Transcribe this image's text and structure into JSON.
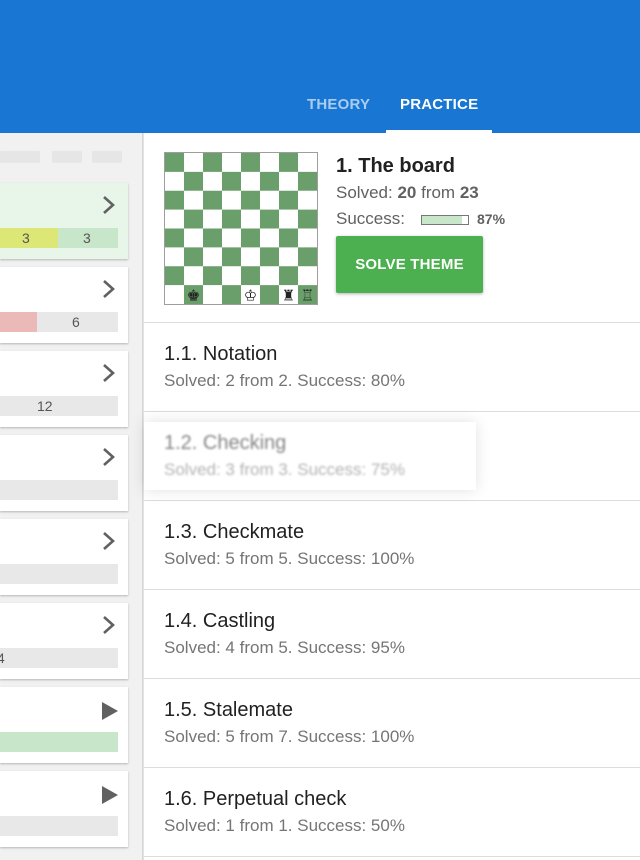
{
  "tabs": [
    {
      "label": "THEORY",
      "selected": false
    },
    {
      "label": "PRACTICE",
      "selected": true
    }
  ],
  "colors": {
    "appbar": "#1976d2",
    "board_dark": "#6a9e6a",
    "board_light": "#ffffff",
    "button": "#4caf50"
  },
  "left_cards": [
    {
      "icon": "chevron-right-icon",
      "values": [
        "3",
        "3"
      ]
    },
    {
      "icon": "chevron-right-icon",
      "values": [
        "6"
      ]
    },
    {
      "icon": "chevron-right-icon",
      "values": [
        "12"
      ]
    },
    {
      "icon": "chevron-right-icon",
      "values": []
    },
    {
      "icon": "chevron-right-icon",
      "values": []
    },
    {
      "icon": "chevron-right-icon",
      "values": [
        "4"
      ]
    },
    {
      "icon": "play-icon",
      "values": []
    },
    {
      "icon": "play-icon",
      "values": []
    }
  ],
  "theme": {
    "title": "1. The board",
    "solved_label": "Solved:",
    "solved": "20",
    "from_label": "from",
    "total": "23",
    "success_label": "Success:",
    "success_fraction": 0.87,
    "success_pct": "87%",
    "button": "SOLVE THEME",
    "board_pieces": [
      {
        "file": "b",
        "rank": 1,
        "glyph": "♚"
      },
      {
        "file": "e",
        "rank": 1,
        "glyph": "♔"
      },
      {
        "file": "g",
        "rank": 1,
        "glyph": "♜"
      },
      {
        "file": "h",
        "rank": 1,
        "glyph": "♖"
      }
    ]
  },
  "items": [
    {
      "title": "1.1. Notation",
      "subtitle": "Solved: 2 from 2. Success: 80%"
    },
    {
      "title": "1.2. Checking",
      "subtitle": "Solved: 3 from 3. Success: 75%"
    },
    {
      "title": "1.3. Checkmate",
      "subtitle": "Solved: 5 from 5. Success: 100%"
    },
    {
      "title": "1.4. Castling",
      "subtitle": "Solved: 4 from 5. Success: 95%"
    },
    {
      "title": "1.5. Stalemate",
      "subtitle": "Solved: 5 from 7. Success: 100%"
    },
    {
      "title": "1.6. Perpetual check",
      "subtitle": "Solved: 1 from 1. Success: 50%"
    }
  ]
}
